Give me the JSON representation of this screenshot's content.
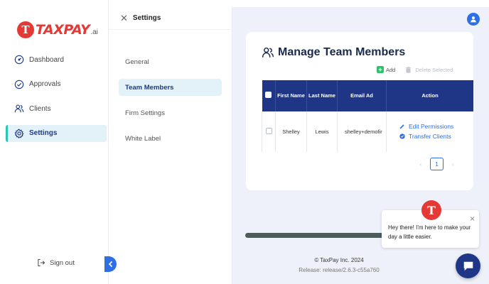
{
  "brand": {
    "logo_mark": "T",
    "name": "TAXPAY",
    "suffix": ".ai",
    "color": "#e53935"
  },
  "sidebar": {
    "items": [
      {
        "label": "Dashboard",
        "icon": "dashboard-icon",
        "active": false
      },
      {
        "label": "Approvals",
        "icon": "check-circle-icon",
        "active": false
      },
      {
        "label": "Clients",
        "icon": "users-icon",
        "active": false
      },
      {
        "label": "Settings",
        "icon": "gear-icon",
        "active": true
      }
    ],
    "sign_out": "Sign out"
  },
  "settings_panel": {
    "title": "Settings",
    "items": [
      {
        "label": "General",
        "active": false
      },
      {
        "label": "Team Members",
        "active": true
      },
      {
        "label": "Firm Settings",
        "active": false
      },
      {
        "label": "White Label",
        "active": false
      }
    ]
  },
  "main": {
    "title": "Manage Team Members",
    "add_label": "Add",
    "delete_label": "Delete Selected",
    "table": {
      "columns": [
        "",
        "First Name",
        "Last Name",
        "Email Ad",
        "Action"
      ],
      "rows": [
        {
          "first": "Shelley",
          "last": "Lewis",
          "email": "shelley+demofir",
          "actions": [
            "Edit Permissions",
            "Transfer Clients"
          ]
        }
      ]
    },
    "pagination": {
      "current": "1",
      "prev": "‹",
      "next": "›"
    },
    "footer": {
      "copyright": "© TaxPay Inc. 2024",
      "release": "Release: release/2.6.3-c55a760"
    }
  },
  "chat": {
    "message": "Hey there! I'm here to make your day a little easier.",
    "close": "×",
    "logo_mark": "T"
  },
  "colors": {
    "accent": "#2f6fe6",
    "navy": "#1f3585",
    "teal": "#2dc4b8",
    "green": "#2dc36a"
  }
}
